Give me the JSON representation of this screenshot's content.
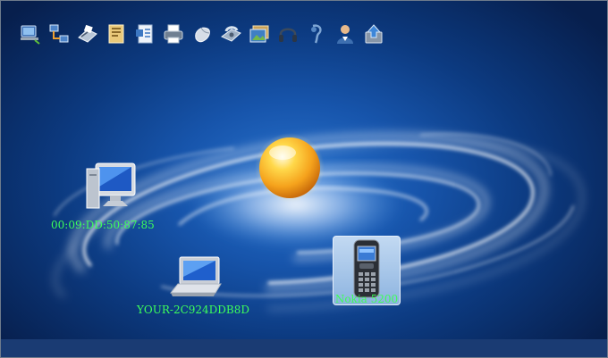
{
  "toolbar": {
    "icons": [
      "network-access-icon",
      "lan-connect-icon",
      "fax-icon",
      "file-transfer-icon",
      "object-push-icon",
      "printer-icon",
      "mouse-icon",
      "dialup-icon",
      "image-transfer-icon",
      "headphones-icon",
      "headset-icon",
      "personal-network-icon",
      "sync-icon"
    ]
  },
  "devices": {
    "desktop_label": "00:09:DD:50:87:85",
    "laptop_label": "YOUR-2C924DDB8D",
    "phone_label": "Nokia 5200"
  },
  "colors": {
    "label_green": "#3dff5a",
    "background_blue": "#1755ac",
    "sun_orange": "#f5a21c"
  }
}
